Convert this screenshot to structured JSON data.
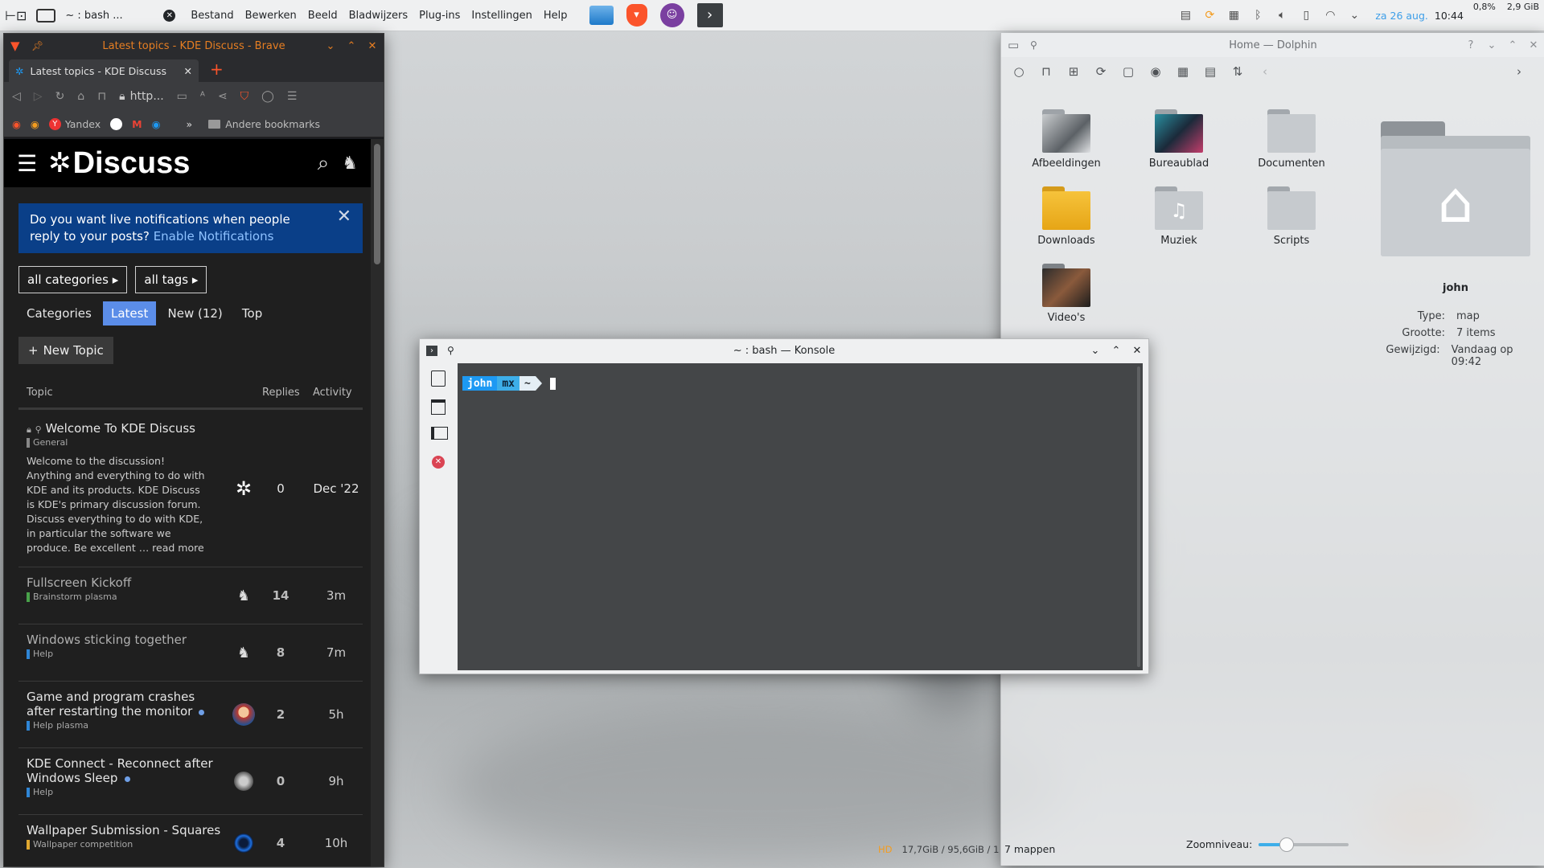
{
  "panel": {
    "active_window": "~ : bash ...",
    "menus": [
      "Bestand",
      "Bewerken",
      "Beeld",
      "Bladwijzers",
      "Plug-ins",
      "Instellingen",
      "Help"
    ],
    "date": "za 26 aug.",
    "time": "10:44",
    "cpu": "0,8%",
    "mem": "2,9 GiB"
  },
  "brave": {
    "title": "Latest topics - KDE Discuss - Brave",
    "tab_title": "Latest topics - KDE Discuss",
    "url": "http...",
    "bookmarks": {
      "yandex": "Yandex",
      "other": "Andere bookmarks"
    },
    "page": {
      "logo": "Discuss",
      "notification": {
        "text": "Do you want live notifications when people reply to your posts?",
        "link": "Enable Notifications"
      },
      "filters": {
        "categories": "all categories",
        "tags": "all tags"
      },
      "nav": [
        "Categories",
        "Latest",
        "New (12)",
        "Top"
      ],
      "new_topic": "New Topic",
      "columns": {
        "topic": "Topic",
        "replies": "Replies",
        "activity": "Activity"
      },
      "pinned": {
        "title": "Welcome To KDE Discuss",
        "category": "General",
        "excerpt": "Welcome to the discussion! Anything and everything to do with KDE and its products. KDE Discuss is KDE's primary discussion forum. Discuss everything to do with KDE, in particular the software we produce. Be excellent … read more",
        "replies": "0",
        "activity": "Dec '22"
      },
      "topics": [
        {
          "title": "Fullscreen Kickoff",
          "category": "Brainstorm",
          "tag": "plasma",
          "replies": "14",
          "activity": "3m"
        },
        {
          "title": "Windows sticking together",
          "category": "Help",
          "tag": "",
          "replies": "8",
          "activity": "7m"
        },
        {
          "title": "Game and program crashes after restarting the monitor",
          "category": "Help",
          "tag": "plasma",
          "replies": "2",
          "activity": "5h"
        },
        {
          "title": "KDE Connect - Reconnect after Windows Sleep",
          "category": "Help",
          "tag": "",
          "replies": "0",
          "activity": "9h"
        },
        {
          "title": "Wallpaper Submission - Squares",
          "category": "Wallpaper competition",
          "tag": "",
          "replies": "4",
          "activity": "10h"
        }
      ]
    }
  },
  "dolphin": {
    "title": "Home — Dolphin",
    "folders": [
      "Afbeeldingen",
      "Bureaublad",
      "Documenten",
      "Downloads",
      "Muziek",
      "Scripts",
      "Video's"
    ],
    "info": {
      "name": "john",
      "type_label": "Type:",
      "type": "map",
      "size_label": "Grootte:",
      "size": "7 items",
      "modified_label": "Gewijzigd:",
      "modified": "Vandaag op 09:42"
    },
    "status": "7 mappen",
    "zoom_label": "Zoomniveau:",
    "zoom_level": 0.3
  },
  "konsole": {
    "title": "~ : bash — Konsole",
    "prompt": {
      "user": "john",
      "host": "mx",
      "path": "~"
    }
  },
  "bottom_status": {
    "hd": "HD",
    "disk": "17,7GiB / 95,6GiB / 1"
  },
  "colors": {
    "brave_orange": "#e67e22",
    "discuss_blue": "#0a3f88",
    "latest_pill": "#5b8de8",
    "prompt_blue": "#1d99f3"
  }
}
